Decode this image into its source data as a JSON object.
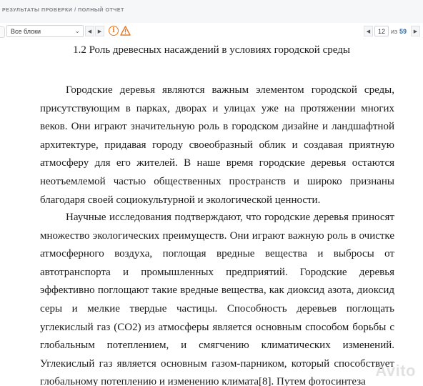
{
  "header": {
    "breadcrumb": "РЕЗУЛЬТАТЫ ПРОВЕРКИ / ПОЛНЫЙ ОТЧЕТ"
  },
  "toolbar": {
    "block_select": {
      "value": "Все блоки"
    },
    "icons": [
      "chevron-down-icon",
      "arrow-left-icon",
      "arrow-right-icon",
      "info-icon",
      "warning-icon"
    ],
    "colors": {
      "info": "#e8731c",
      "warning": "#e8731c",
      "accent": "#2f6fb3"
    }
  },
  "pager": {
    "current": "12",
    "of_label": "из",
    "total": "59"
  },
  "document": {
    "heading": "1.2 Роль древесных насаждений в условиях городской среды",
    "paragraph_1": "Городские деревья являются важным элементом городской среды, присутствующим в парках, дворах и улицах уже на протяжении многих веков. Они играют значительную роль в городском дизайне и ландшафтной архитектуре, придавая городу своеобразный облик и создавая приятную атмосферу для его жителей. В наше время городские деревья остаются неотъемлемой частью общественных пространств и широко признаны благодаря своей социокультурной и экологической ценности.",
    "paragraph_2": "Научные исследования подтверждают, что городские деревья приносят множество экологических преимуществ. Они играют важную роль в очистке атмосферного воздуха, поглощая вредные вещества и выбросы от автотранспорта и промышленных предприятий. Городские деревья эффективно поглощают такие вредные вещества, как диоксид азота, диоксид серы и мелкие твердые частицы. Способность деревьев поглощать углекислый газ (CO2) из атмосферы является основным способом борьбы с глобальным потеплением, и смягчению климатических изменений. Углекислый газ является основным газом-парником, который способствует глобальному потеплению и изменению климата[8]. Путем фотосинтеза"
  },
  "watermark": "Avito"
}
